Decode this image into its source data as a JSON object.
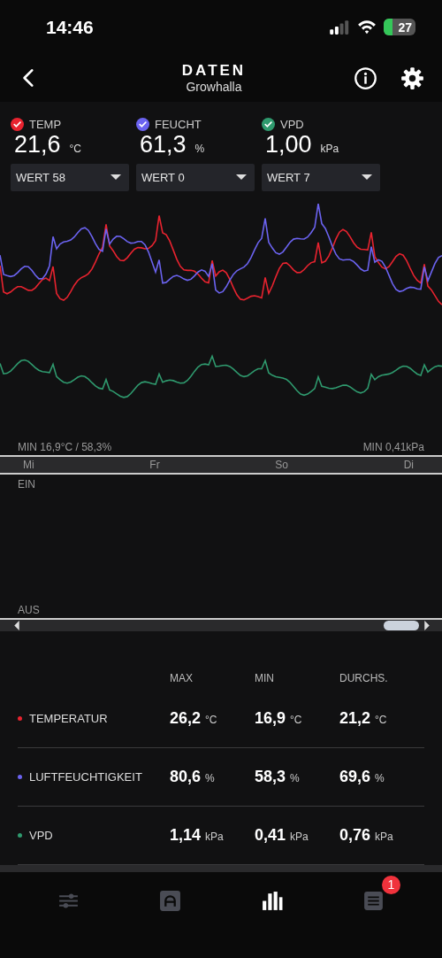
{
  "status_bar": {
    "time": "14:46",
    "battery": "27"
  },
  "header": {
    "title": "DATEN",
    "subtitle": "Growhalla"
  },
  "sensors": [
    {
      "label": "TEMP",
      "color": "#e8232f",
      "checked": true,
      "value": "21,6",
      "unit": "°C",
      "dropdown": "WERT 58"
    },
    {
      "label": "FEUCHT",
      "color": "#6b63f0",
      "checked": true,
      "value": "61,3",
      "unit": "%",
      "dropdown": "WERT 0"
    },
    {
      "label": "VPD",
      "color": "#2f9a6e",
      "checked": true,
      "value": "1,00",
      "unit": "kPa",
      "dropdown": "WERT 7"
    }
  ],
  "chart": {
    "min_left": "MIN 16,9°C / 58,3%",
    "min_right": "MIN 0,41kPa",
    "x_labels": [
      "Mi",
      "Fr",
      "So",
      "Di"
    ]
  },
  "switch_chart": {
    "on_label": "EIN",
    "off_label": "AUS"
  },
  "stats": {
    "columns": [
      "MAX",
      "MIN",
      "DURCHS."
    ],
    "rows": [
      {
        "name": "TEMPERATUR",
        "color": "#e8232f",
        "values": [
          {
            "value": "26,2",
            "unit": "°C"
          },
          {
            "value": "16,9",
            "unit": "°C"
          },
          {
            "value": "21,2",
            "unit": "°C"
          }
        ]
      },
      {
        "name": "LUFTFEUCHTIGKEIT",
        "color": "#6b63f0",
        "values": [
          {
            "value": "80,6",
            "unit": "%"
          },
          {
            "value": "58,3",
            "unit": "%"
          },
          {
            "value": "69,6",
            "unit": "%"
          }
        ]
      },
      {
        "name": "VPD",
        "color": "#2f9a6e",
        "values": [
          {
            "value": "1,14",
            "unit": "kPa"
          },
          {
            "value": "0,41",
            "unit": "kPa"
          },
          {
            "value": "0,76",
            "unit": "kPa"
          }
        ]
      }
    ]
  },
  "tab_bar": [
    {
      "kind": "sliders",
      "selected": false
    },
    {
      "kind": "mode",
      "selected": false
    },
    {
      "kind": "chart",
      "selected": true
    },
    {
      "kind": "list",
      "selected": false,
      "badge": "1"
    }
  ]
}
